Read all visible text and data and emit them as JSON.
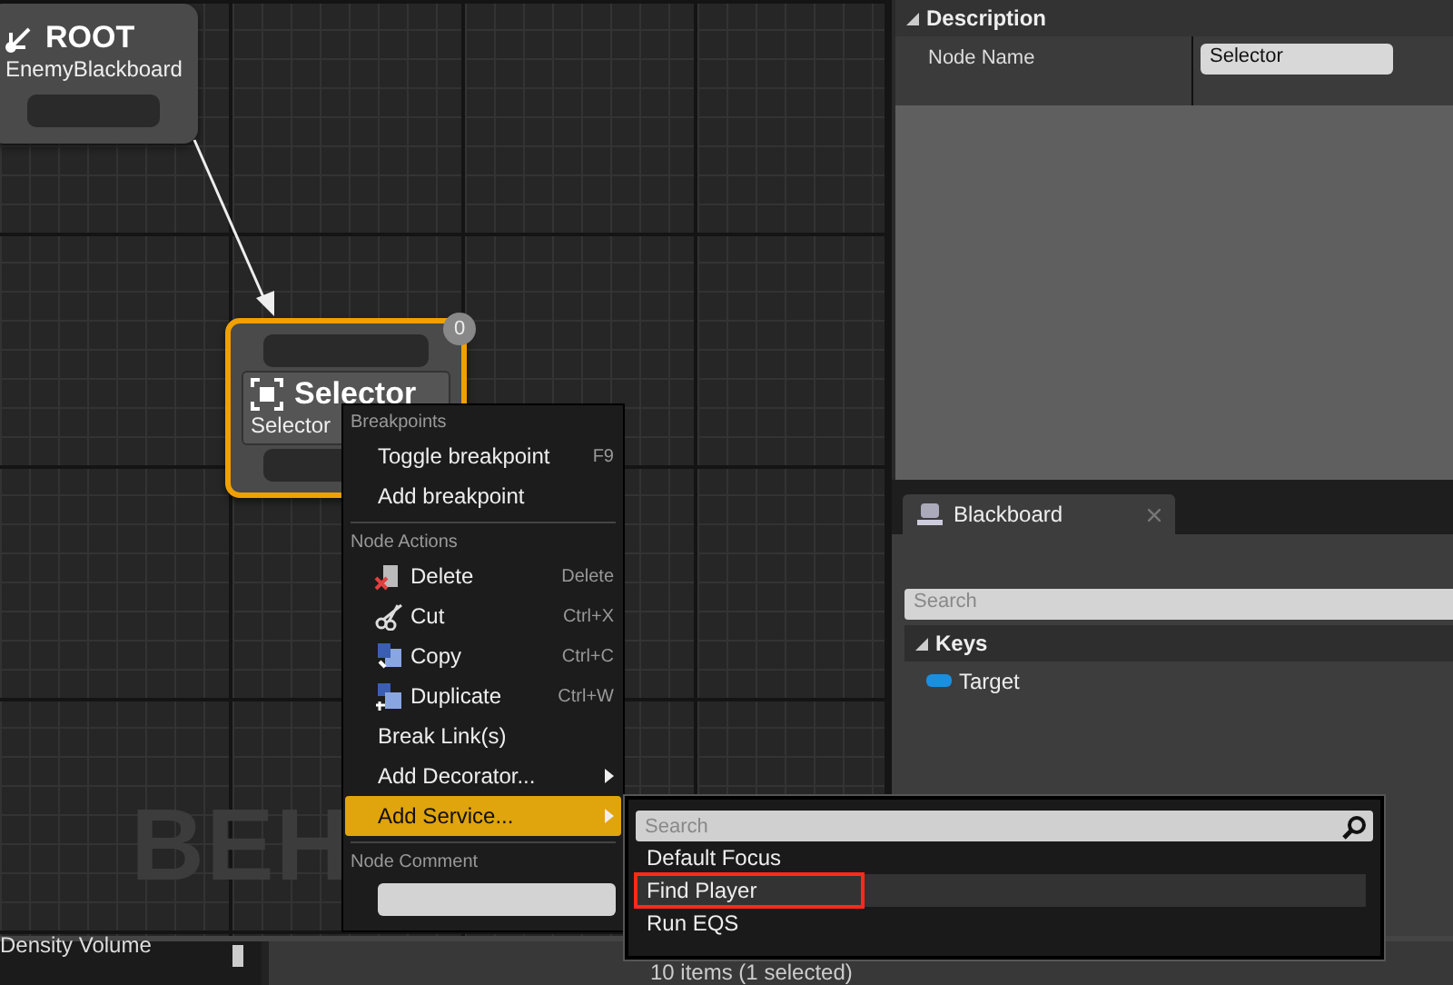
{
  "graph": {
    "watermark": "BEH",
    "nodes": [
      {
        "kind": "root",
        "title": "ROOT",
        "subtitle": "EnemyBlackboard",
        "selected": false
      },
      {
        "kind": "composite",
        "title": "Selector",
        "subtitle": "Selector",
        "selected": true,
        "badge": "0"
      }
    ]
  },
  "context_menu": {
    "sections": [
      {
        "heading": "Breakpoints",
        "items": [
          {
            "label": "Toggle breakpoint",
            "shortcut": "F9",
            "selected": false
          },
          {
            "label": "Add breakpoint",
            "selected": false
          }
        ]
      },
      {
        "heading": "Node Actions",
        "items": [
          {
            "label": "Delete",
            "shortcut": "Delete",
            "kind": "delete",
            "selected": false
          },
          {
            "label": "Cut",
            "shortcut": "Ctrl+X",
            "kind": "cut",
            "selected": false
          },
          {
            "label": "Copy",
            "shortcut": "Ctrl+C",
            "kind": "copy",
            "selected": false
          },
          {
            "label": "Duplicate",
            "shortcut": "Ctrl+W",
            "kind": "duplicate",
            "selected": false
          },
          {
            "label": "Break Link(s)",
            "selected": false
          },
          {
            "label": "Add Decorator...",
            "submenu": true,
            "selected": false
          },
          {
            "label": "Add Service...",
            "submenu": true,
            "selected": true
          }
        ]
      },
      {
        "heading": "Node Comment",
        "kind": "comment"
      }
    ]
  },
  "service_menu": {
    "search": {
      "placeholder": "Search"
    },
    "items": [
      {
        "label": "Default Focus",
        "selected": false,
        "highlighted": false
      },
      {
        "label": "Find Player",
        "selected": true,
        "highlighted": true
      },
      {
        "label": "Run EQS",
        "selected": false,
        "highlighted": false
      }
    ]
  },
  "details": {
    "section": "Description",
    "expanded": true,
    "rows": [
      {
        "label": "Node Name",
        "value": "Selector"
      }
    ]
  },
  "blackboard": {
    "tab": "Blackboard",
    "search": {
      "placeholder": "Search"
    },
    "group": "Keys",
    "expanded": true,
    "keys": [
      {
        "name": "Target"
      }
    ]
  },
  "bottom": {
    "left_item": "Density Volume",
    "status": "10 items (1 selected)"
  }
}
